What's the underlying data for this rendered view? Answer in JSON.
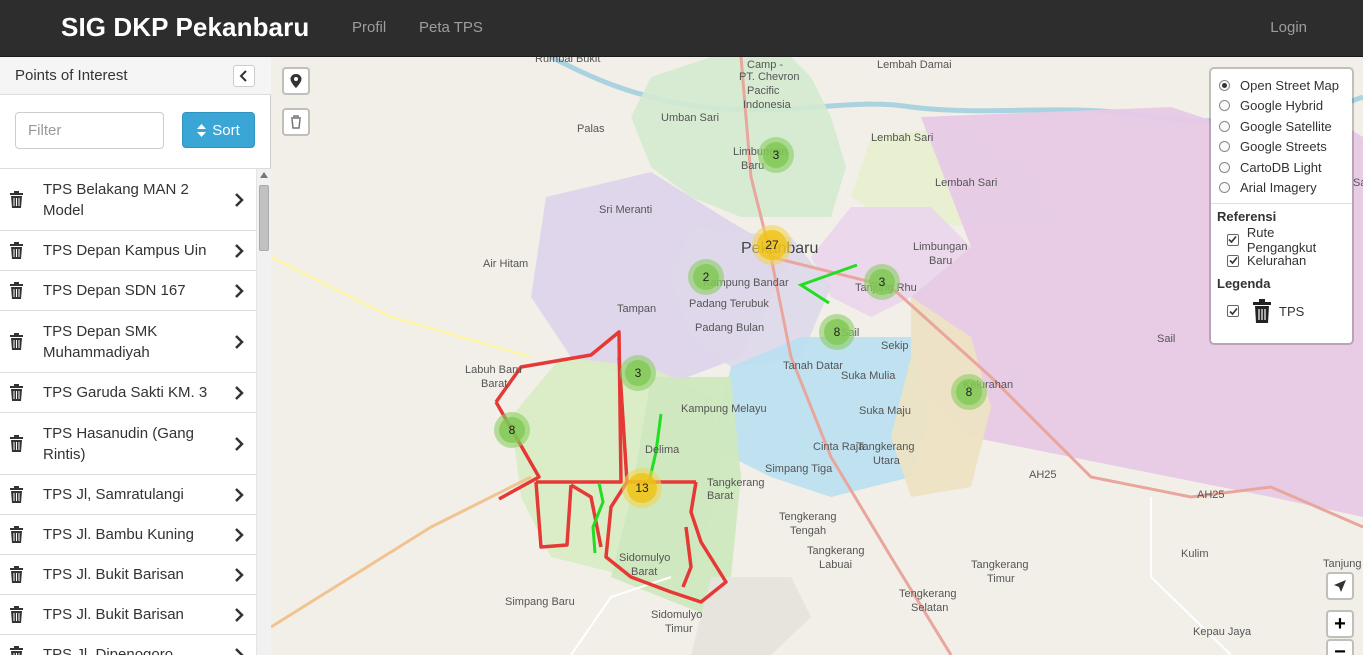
{
  "app": {
    "brand": "SIG DKP Pekanbaru",
    "nav": {
      "profil": "Profil",
      "peta_tps": "Peta TPS",
      "login": "Login"
    }
  },
  "sidebar": {
    "title": "Points of Interest",
    "filter_placeholder": "Filter",
    "sort_label": "Sort",
    "items": [
      {
        "label": "TPS Belakang MAN 2 Model"
      },
      {
        "label": "TPS Depan Kampus Uin"
      },
      {
        "label": "TPS Depan SDN 167"
      },
      {
        "label": "TPS Depan SMK Muhammadiyah"
      },
      {
        "label": "TPS Garuda Sakti KM. 3"
      },
      {
        "label": "TPS Hasanudin (Gang Rintis)"
      },
      {
        "label": "TPS Jl, Samratulangi"
      },
      {
        "label": "TPS Jl. Bambu Kuning"
      },
      {
        "label": "TPS Jl. Bukit Barisan"
      },
      {
        "label": "TPS Jl. Bukit Barisan"
      },
      {
        "label": "TPS Jl. Dipenogoro"
      }
    ]
  },
  "map": {
    "places": {
      "rumbai_bukit": "Rumbai Bukit",
      "lembah_damai": "Lembah Damai",
      "camp_1": "Camp -",
      "camp_2": "PT. Chevron",
      "camp_3": "Pacific",
      "camp_4": "Indonesia",
      "umban_sari": "Umban Sari",
      "palas": "Palas",
      "lembah_sari_1": "Lembah Sari",
      "limbungan_baru_1a": "Limbungan",
      "limbungan_baru_1b": "Baru",
      "lembah_sari_2": "Lembah Sari",
      "sri_meranti": "Sri Meranti",
      "pekanbaru": "Pekanbaru",
      "limbungan_baru_2a": "Limbungan",
      "limbungan_baru_2b": "Baru",
      "air_hitam": "Air Hitam",
      "kampung_bandar": "Kampung Bandar",
      "padang_terubuk": "Padang Terubuk",
      "tanjung_rhu": "Tanjung Rhu",
      "tampan": "Tampan",
      "padang_bulan": "Padang Bulan",
      "sail_1": "Sail",
      "sekip": "Sekip",
      "sail_2": "Sail",
      "tanah_datar": "Tanah Datar",
      "suka_mulia": "Suka Mulia",
      "labuh_baru_a": "Labuh Baru",
      "labuh_baru_b": "Barat",
      "kelurahan": "Kelurahan",
      "kampung_melayu": "Kampung Melayu",
      "suka_maju": "Suka Maju",
      "cinta_raja": "Cinta Raja",
      "tangkerang_utara_a": "Tangkerang",
      "tangkerang_utara_b": "Utara",
      "delima": "Delima",
      "simpang_tiga": "Simpang Tiga",
      "tangkerang_barat_a": "Tangkerang",
      "tangkerang_barat_b": "Barat",
      "ah25_1": "AH25",
      "ah25_2": "AH25",
      "tengkerang_tengah_a": "Tengkerang",
      "tengkerang_tengah_b": "Tengah",
      "kulim": "Kulim",
      "sidomulyo_barat_a": "Sidomulyo",
      "sidomulyo_barat_b": "Barat",
      "tangkerang_labuai_a": "Tangkerang",
      "tangkerang_labuai_b": "Labuai",
      "tangkerang_timur_a": "Tangkerang",
      "tangkerang_timur_b": "Timur",
      "simpang_baru": "Simpang Baru",
      "tengkerang_selatan_a": "Tengkerang",
      "tengkerang_selatan_b": "Selatan",
      "sidomulyo_timur_a": "Sidomulyo",
      "sidomulyo_timur_b": "Timur",
      "kepau_jaya": "Kepau Jaya",
      "tanjung_ba": "Tanjung Ba",
      "sail_3": "Sail"
    },
    "clusters": [
      {
        "count": "3",
        "color": "green"
      },
      {
        "count": "27",
        "color": "yellow"
      },
      {
        "count": "2",
        "color": "green"
      },
      {
        "count": "3",
        "color": "green"
      },
      {
        "count": "8",
        "color": "green"
      },
      {
        "count": "3",
        "color": "green"
      },
      {
        "count": "8",
        "color": "green"
      },
      {
        "count": "8",
        "color": "green"
      },
      {
        "count": "13",
        "color": "yellow"
      }
    ],
    "zoom_in": "+",
    "zoom_out": "−"
  },
  "layer_control": {
    "base_layers": [
      {
        "label": "Open Street Map",
        "checked": true
      },
      {
        "label": "Google Hybrid",
        "checked": false
      },
      {
        "label": "Google Satellite",
        "checked": false
      },
      {
        "label": "Google Streets",
        "checked": false
      },
      {
        "label": "CartoDB Light",
        "checked": false
      },
      {
        "label": "Arial Imagery",
        "checked": false
      }
    ],
    "referensi_title": "Referensi",
    "overlays": [
      {
        "label": "Rute Pengangkut",
        "checked": true
      },
      {
        "label": "Kelurahan",
        "checked": true
      }
    ],
    "legenda_title": "Legenda",
    "legend_items": [
      {
        "label": "TPS",
        "checked": true
      }
    ]
  },
  "colors": {
    "navbar": "#2d2d2d",
    "sort_button": "#3aa6d6",
    "route_red": "#e53935",
    "route_green": "#22dd22",
    "cluster_green": "#7ec750",
    "cluster_yellow": "#f0c20c"
  }
}
